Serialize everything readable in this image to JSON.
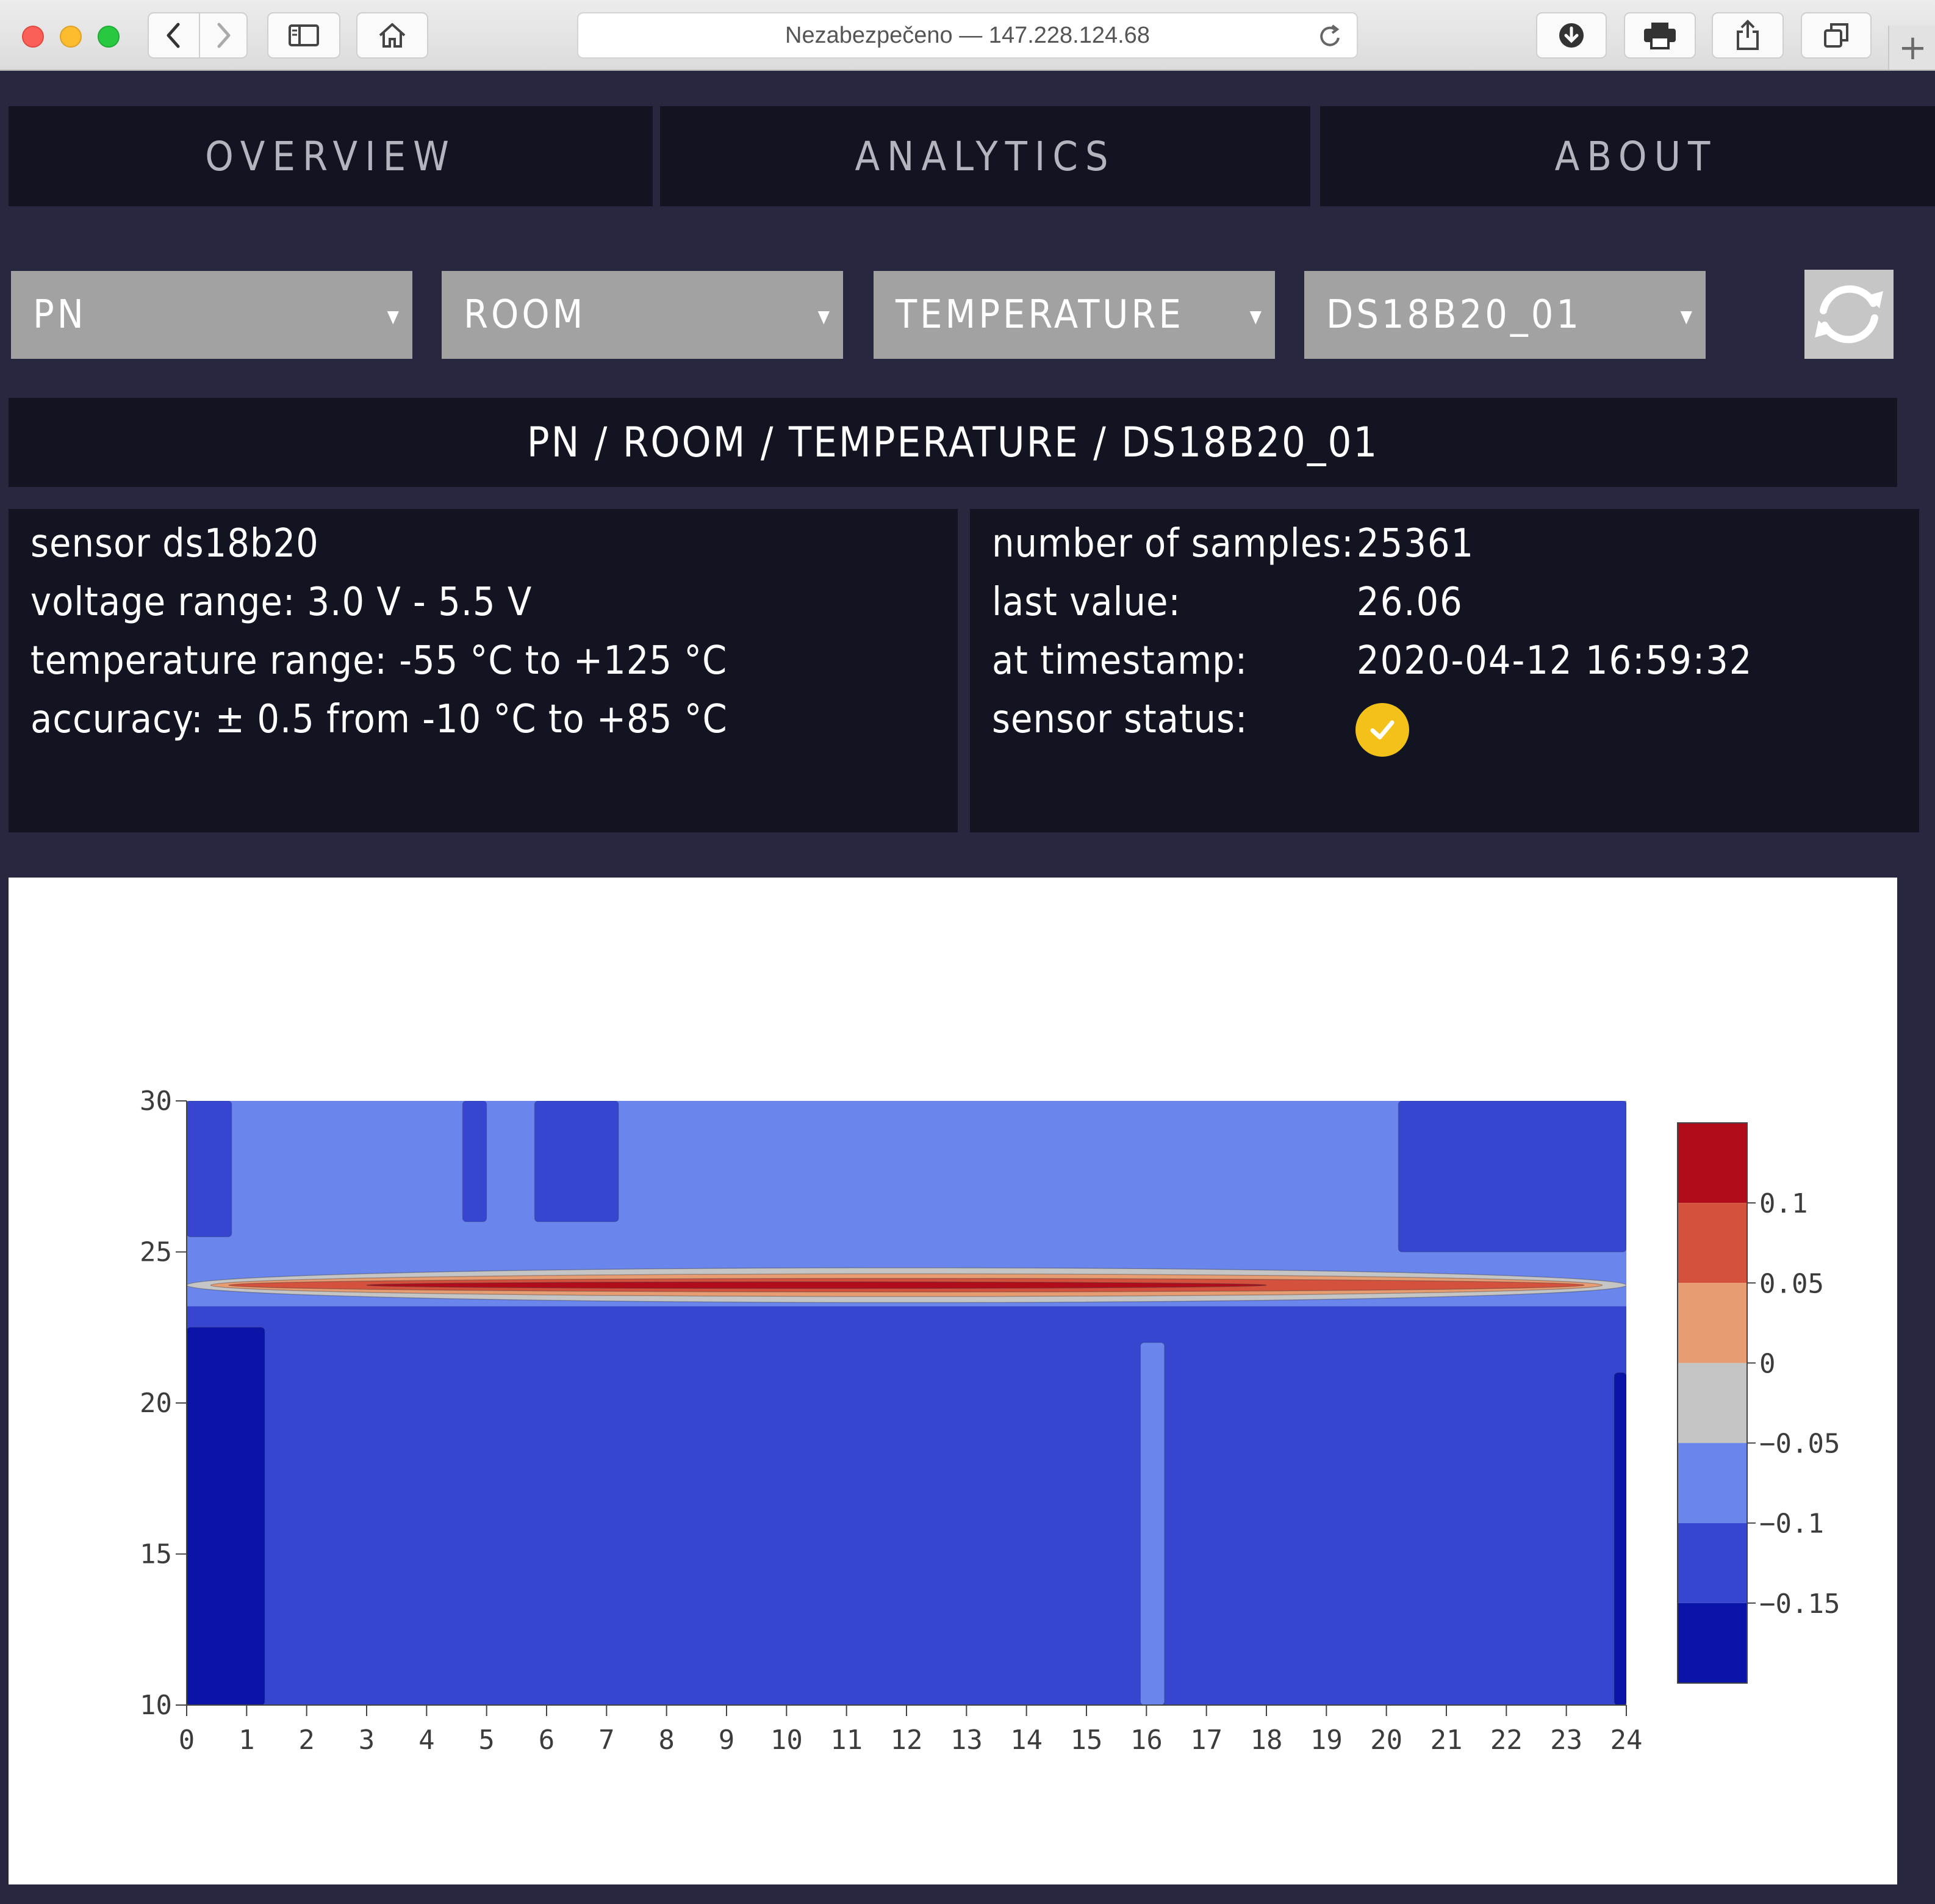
{
  "browser": {
    "url_text": "Nezabezpečeno — 147.228.124.68",
    "new_tab_label": "+"
  },
  "nav": {
    "tabs": [
      {
        "label": "OVERVIEW"
      },
      {
        "label": "ANALYTICS"
      },
      {
        "label": "ABOUT"
      }
    ]
  },
  "filters": {
    "dropdowns": [
      {
        "value": "PN"
      },
      {
        "value": "ROOM"
      },
      {
        "value": "TEMPERATURE"
      },
      {
        "value": "DS18B20_01"
      }
    ],
    "caret": "▼"
  },
  "breadcrumb": "PN / ROOM / TEMPERATURE / DS18B20_01",
  "sensor_info": {
    "lines": [
      "sensor ds18b20",
      "voltage range: 3.0 V - 5.5 V",
      "temperature range: -55 °C to +125 °C",
      "accuracy: ± 0.5 from -10 °C to +85 °C"
    ]
  },
  "stats": {
    "labels": [
      "number of samples:",
      "last value:",
      "at timestamp:",
      "sensor status:"
    ],
    "samples": "25361",
    "last_value": "26.06",
    "timestamp": "2020-04-12 16:59:32",
    "status": "ok",
    "status_icon": "check-circle-icon",
    "status_color": "#f3c11a"
  },
  "chart_data": {
    "type": "heatmap",
    "subtype": "contour",
    "title": "",
    "xlabel": "",
    "ylabel": "",
    "xlim": [
      0,
      24
    ],
    "ylim": [
      10,
      30
    ],
    "x_ticks": [
      "0",
      "1",
      "2",
      "3",
      "4",
      "5",
      "6",
      "7",
      "8",
      "9",
      "10",
      "11",
      "12",
      "13",
      "14",
      "15",
      "16",
      "17",
      "18",
      "19",
      "20",
      "21",
      "22",
      "23",
      "24"
    ],
    "y_ticks": [
      "10",
      "15",
      "20",
      "25",
      "30"
    ],
    "colorbar": {
      "tick_labels": [
        "0.1",
        "0.05",
        "0",
        "−0.05",
        "−0.1",
        "−0.15"
      ],
      "tick_values": [
        0.1,
        0.05,
        0,
        -0.05,
        -0.1,
        -0.15
      ],
      "range": [
        -0.2,
        0.15
      ],
      "bands": [
        {
          "from": 0.1,
          "to": 0.15,
          "color": "#b10c1c"
        },
        {
          "from": 0.05,
          "to": 0.1,
          "color": "#d4513d"
        },
        {
          "from": 0,
          "to": 0.05,
          "color": "#e79c72"
        },
        {
          "from": -0.05,
          "to": 0,
          "color": "#c5c5c5"
        },
        {
          "from": -0.1,
          "to": -0.05,
          "color": "#6a85eb"
        },
        {
          "from": -0.15,
          "to": -0.1,
          "color": "#3646cf"
        },
        {
          "from": -0.2,
          "to": -0.15,
          "color": "#0a14a6"
        }
      ]
    },
    "regions": [
      {
        "level": -0.175,
        "x": [
          0,
          1.3
        ],
        "y": [
          10,
          22.5
        ],
        "color": "#0a14a6"
      },
      {
        "level": -0.175,
        "x": [
          23.8,
          24
        ],
        "y": [
          10,
          21
        ],
        "color": "#0a14a6"
      },
      {
        "level": -0.075,
        "x": [
          15.9,
          16.3
        ],
        "y": [
          10,
          22
        ],
        "color": "#6a85eb"
      },
      {
        "level": -0.125,
        "x": [
          0,
          0.75
        ],
        "y": [
          25.5,
          30
        ],
        "color": "#3646cf"
      },
      {
        "level": -0.125,
        "x": [
          4.6,
          5
        ],
        "y": [
          26,
          30
        ],
        "color": "#3646cf"
      },
      {
        "level": -0.125,
        "x": [
          5.8,
          7.2
        ],
        "y": [
          26,
          30
        ],
        "color": "#3646cf"
      },
      {
        "level": -0.125,
        "x": [
          20.2,
          24
        ],
        "y": [
          25,
          30
        ],
        "color": "#3646cf"
      }
    ],
    "ridge": {
      "center_y": 23.9,
      "x": [
        0,
        24
      ],
      "peak_level": 0.125
    }
  }
}
